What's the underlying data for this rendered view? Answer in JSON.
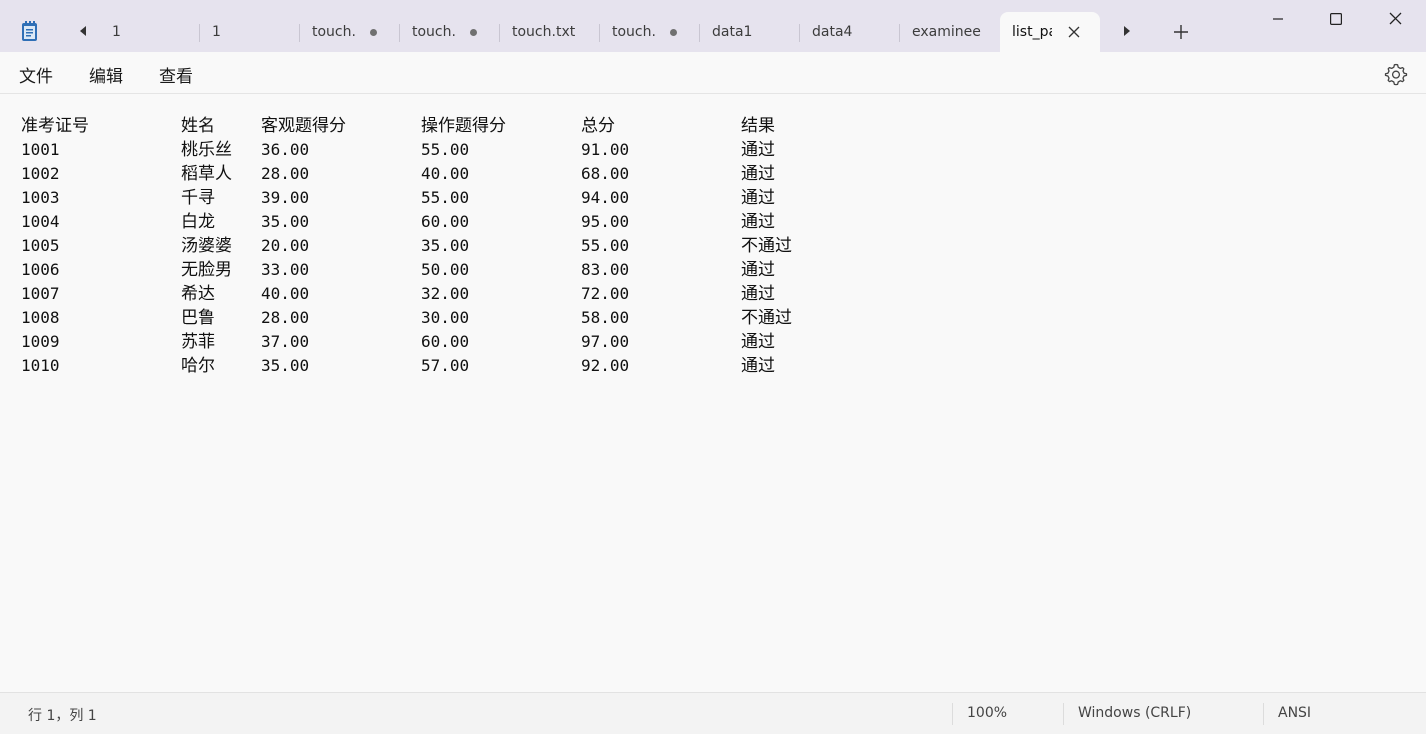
{
  "tabs": [
    {
      "label": "1",
      "dirty": false,
      "active": false
    },
    {
      "label": "1",
      "dirty": false,
      "active": false
    },
    {
      "label": "touch.",
      "dirty": true,
      "active": false
    },
    {
      "label": "touch.",
      "dirty": true,
      "active": false
    },
    {
      "label": "touch.txt",
      "dirty": false,
      "active": false
    },
    {
      "label": "touch.",
      "dirty": true,
      "active": false
    },
    {
      "label": "data1",
      "dirty": false,
      "active": false
    },
    {
      "label": "data4",
      "dirty": false,
      "active": false
    },
    {
      "label": "examinee",
      "dirty": false,
      "active": false
    },
    {
      "label": "list_pa",
      "dirty": false,
      "active": true
    }
  ],
  "menu": {
    "file": "文件",
    "edit": "编辑",
    "view": "查看"
  },
  "document": {
    "header": [
      "准考证号",
      "姓名",
      "客观题得分",
      "操作题得分",
      "总分",
      "结果"
    ],
    "rows": [
      [
        "1001",
        "桃乐丝",
        "36.00",
        "55.00",
        "91.00",
        "通过"
      ],
      [
        "1002",
        "稻草人",
        "28.00",
        "40.00",
        "68.00",
        "通过"
      ],
      [
        "1003",
        "千寻",
        "39.00",
        "55.00",
        "94.00",
        "通过"
      ],
      [
        "1004",
        "白龙",
        "35.00",
        "60.00",
        "95.00",
        "通过"
      ],
      [
        "1005",
        "汤婆婆",
        "20.00",
        "35.00",
        "55.00",
        "不通过"
      ],
      [
        "1006",
        "无脸男",
        "33.00",
        "50.00",
        "83.00",
        "通过"
      ],
      [
        "1007",
        "希达",
        "40.00",
        "32.00",
        "72.00",
        "通过"
      ],
      [
        "1008",
        "巴鲁",
        "28.00",
        "30.00",
        "58.00",
        "不通过"
      ],
      [
        "1009",
        "苏菲",
        "37.00",
        "60.00",
        "97.00",
        "通过"
      ],
      [
        "1010",
        "哈尔",
        "35.00",
        "57.00",
        "92.00",
        "通过"
      ]
    ]
  },
  "status": {
    "position": "行 1，列 1",
    "zoom": "100%",
    "line_ending": "Windows (CRLF)",
    "encoding": "ANSI"
  },
  "icons": {
    "app": "notepad-icon",
    "scroll_left": "caret-left-icon",
    "scroll_right": "caret-right-icon",
    "new_tab": "plus-icon",
    "close_tab": "close-icon",
    "settings": "gear-icon"
  }
}
